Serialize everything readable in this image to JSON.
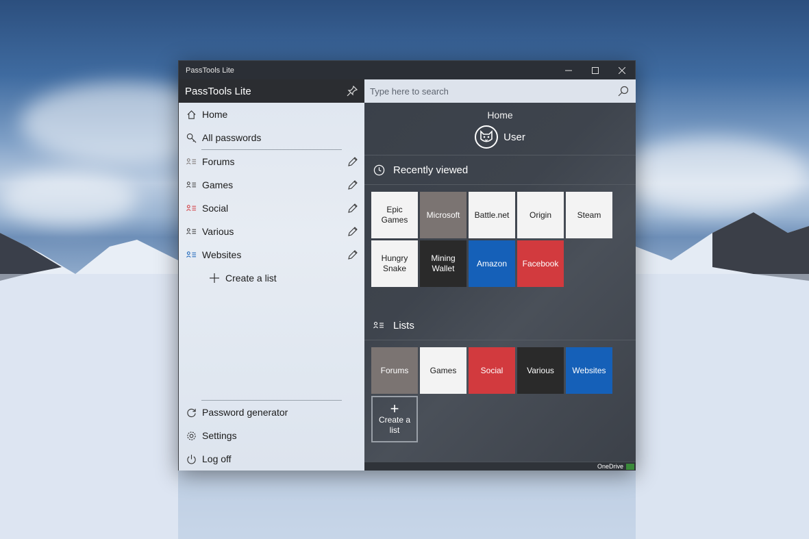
{
  "window": {
    "title": "PassTools Lite",
    "controls": {
      "minimize": "—",
      "maximize": "☐",
      "close": "✕"
    }
  },
  "sidebar": {
    "app_name": "PassTools Lite",
    "top_items": [
      {
        "label": "Home",
        "icon": "home-icon"
      },
      {
        "label": "All passwords",
        "icon": "key-icon"
      }
    ],
    "lists": [
      {
        "label": "Forums",
        "color": "#7b7472"
      },
      {
        "label": "Games",
        "color": "#3a3a3a"
      },
      {
        "label": "Social",
        "color": "#d23a3e"
      },
      {
        "label": "Various",
        "color": "#3a3a3a"
      },
      {
        "label": "Websites",
        "color": "#1560b8"
      }
    ],
    "create_list": "Create a list",
    "bottom_items": [
      {
        "label": "Password generator",
        "icon": "refresh-icon"
      },
      {
        "label": "Settings",
        "icon": "gear-icon"
      },
      {
        "label": "Log off",
        "icon": "power-icon"
      }
    ]
  },
  "search": {
    "placeholder": "Type here to search"
  },
  "main": {
    "page_title": "Home",
    "user_name": "User",
    "recently_viewed": {
      "title": "Recently viewed",
      "tiles": [
        {
          "label": "Epic Games",
          "style": "light"
        },
        {
          "label": "Microsoft",
          "style": "gray"
        },
        {
          "label": "Battle.net",
          "style": "light"
        },
        {
          "label": "Origin",
          "style": "light"
        },
        {
          "label": "Steam",
          "style": "light"
        },
        {
          "label": "Hungry Snake",
          "style": "light"
        },
        {
          "label": "Mining Wallet",
          "style": "dark"
        },
        {
          "label": "Amazon",
          "style": "blue"
        },
        {
          "label": "Facebook",
          "style": "red"
        }
      ]
    },
    "lists": {
      "title": "Lists",
      "tiles": [
        {
          "label": "Forums",
          "style": "gray"
        },
        {
          "label": "Games",
          "style": "light"
        },
        {
          "label": "Social",
          "style": "red"
        },
        {
          "label": "Various",
          "style": "dark"
        },
        {
          "label": "Websites",
          "style": "blue"
        }
      ],
      "create_label": "Create a list"
    }
  },
  "status": {
    "sync_label": "OneDrive"
  }
}
